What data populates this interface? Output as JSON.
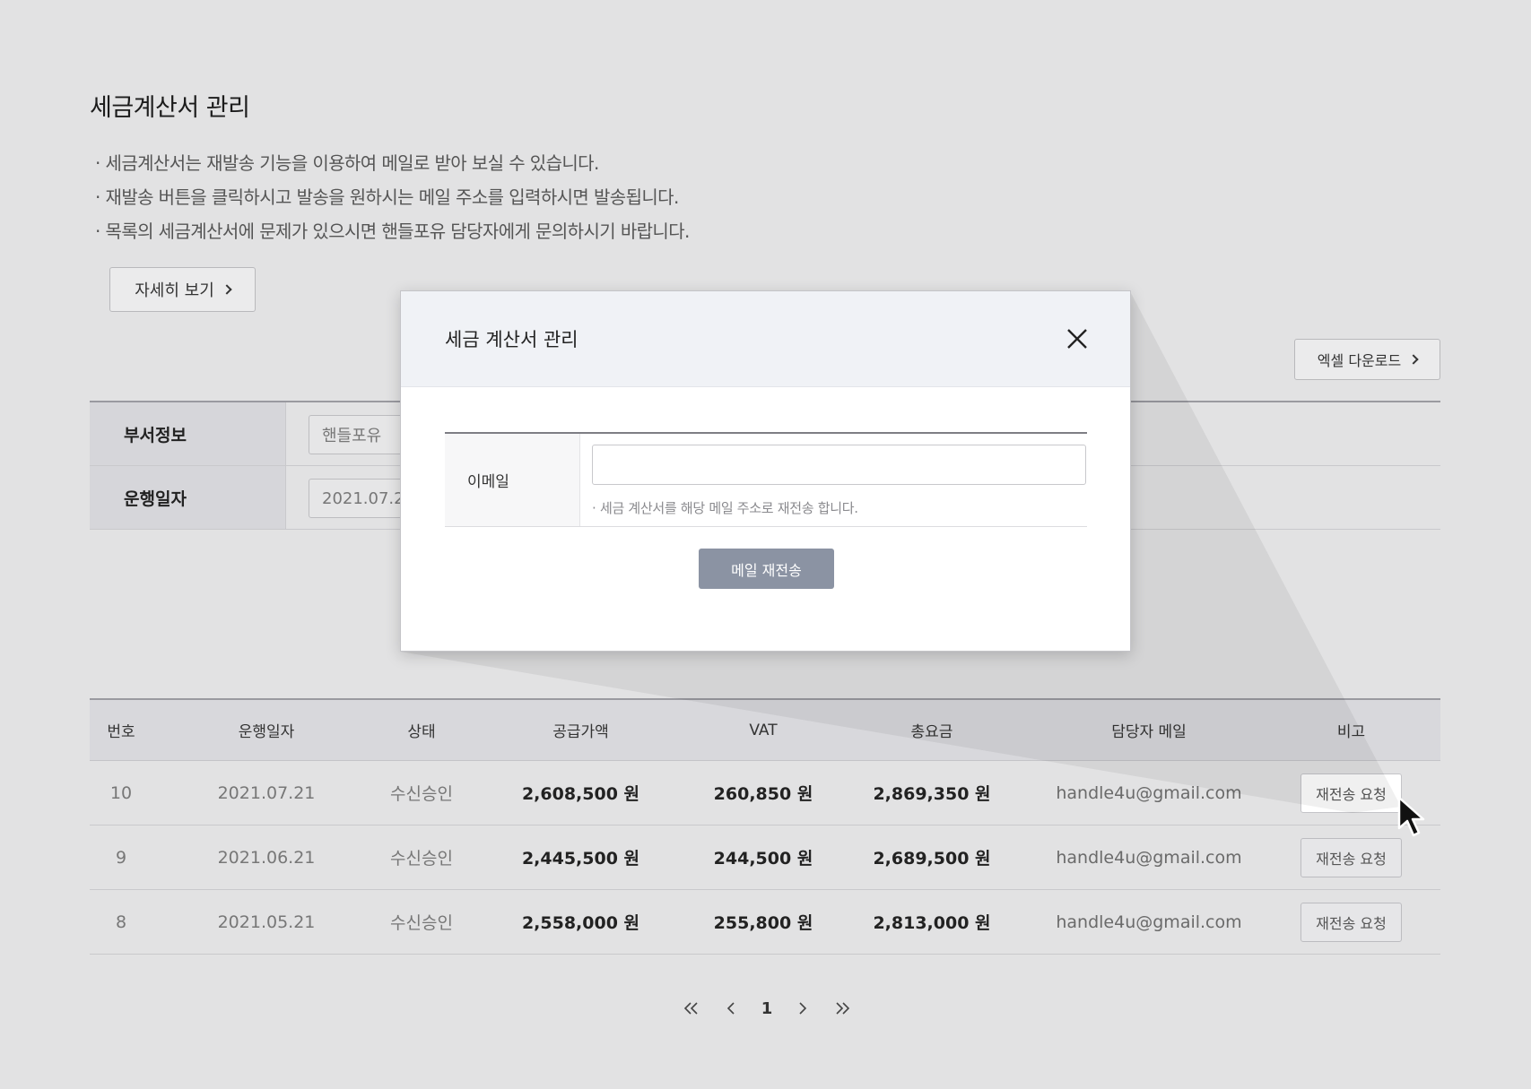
{
  "page": {
    "title": "세금계산서 관리",
    "notices": [
      "세금계산서는 재발송 기능을 이용하여 메일로 받아 보실 수 있습니다.",
      "재발송 버튼을 클릭하시고 발송을 원하시는 메일 주소를 입력하시면 발송됩니다.",
      "목록의 세금계산서에 문제가 있으시면 핸들포유 담당자에게 문의하시기 바랍니다."
    ],
    "detail_button": "자세히 보기",
    "excel_button": "엑셀 다운로드"
  },
  "filter": {
    "rows": [
      {
        "label": "부서정보",
        "value": "핸들포유"
      },
      {
        "label": "운행일자",
        "value": "2021.07.24"
      }
    ]
  },
  "table": {
    "headers": [
      "번호",
      "운행일자",
      "상태",
      "공급가액",
      "VAT",
      "총요금",
      "담당자 메일",
      "비고"
    ],
    "rows": [
      {
        "no": "10",
        "date": "2021.07.21",
        "status": "수신승인",
        "supply": "2,608,500 원",
        "vat": "260,850 원",
        "total": "2,869,350 원",
        "email": "handle4u@gmail.com",
        "action": "재전송 요청"
      },
      {
        "no": "9",
        "date": "2021.06.21",
        "status": "수신승인",
        "supply": "2,445,500 원",
        "vat": "244,500 원",
        "total": "2,689,500 원",
        "email": "handle4u@gmail.com",
        "action": "재전송 요청"
      },
      {
        "no": "8",
        "date": "2021.05.21",
        "status": "수신승인",
        "supply": "2,558,000 원",
        "vat": "255,800 원",
        "total": "2,813,000 원",
        "email": "handle4u@gmail.com",
        "action": "재전송 요청"
      }
    ]
  },
  "pagination": {
    "current": "1",
    "icons": [
      "double-chevron-left-icon",
      "chevron-left-icon",
      "chevron-right-icon",
      "double-chevron-right-icon"
    ]
  },
  "modal": {
    "title": "세금 계산서 관리",
    "email_label": "이메일",
    "email_value": "",
    "email_placeholder": "",
    "hint": "세금 계산서를 해당 메일 주소로 재전송 합니다.",
    "submit": "메일 재전송"
  },
  "colors": {
    "background": "#e2e2e3",
    "modal_header": "#f0f2f6",
    "submit_button": "#8b93a3"
  }
}
